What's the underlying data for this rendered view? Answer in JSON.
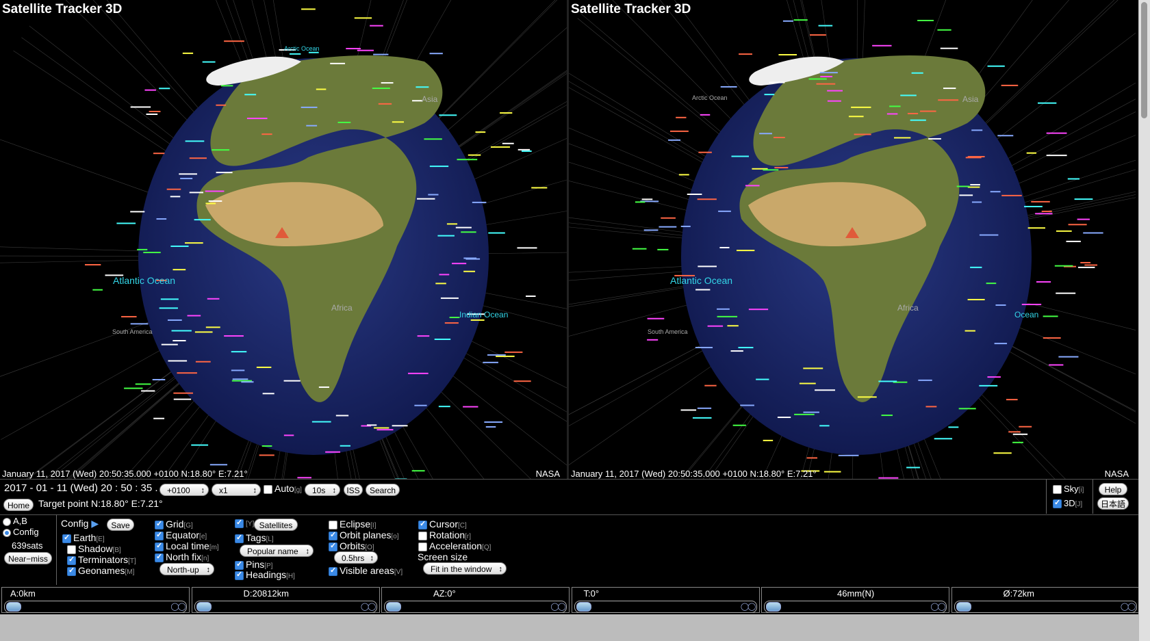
{
  "views": [
    {
      "title": "Satellite Tracker 3D",
      "status": "January 11, 2017 (Wed) 20:50:35.000 +0100 N:18.80° E:7.21°",
      "credit": "NASA",
      "labels": {
        "atlantic": "Atlantic Ocean",
        "indian": "Indian Ocean",
        "africa": "Africa",
        "asia": "Asia",
        "south_america": "South America",
        "arctic": "Arctic Ocean"
      }
    },
    {
      "title": "Satellite Tracker 3D",
      "status": "January 11, 2017 (Wed) 20:50:35.000 +0100 N:18.80° E:7.21°",
      "credit": "NASA",
      "labels": {
        "atlantic": "Atlantic Ocean",
        "indian": "Ocean",
        "africa": "Africa",
        "asia": "Asia",
        "south_america": "South America",
        "arctic": "Arctic Ocean"
      }
    }
  ],
  "time_bar": {
    "datetime": "2017 - 01 - 11 (Wed) 20 : 50 : 35 . 000",
    "timezone": "+0100",
    "speed": "x1",
    "auto_label": "Auto",
    "auto_key": "[g]",
    "interval": "10s",
    "iss_button": "ISS",
    "search_button": "Search",
    "home_button": "Home",
    "target_point": "Target point N:18.80° E:7.21°",
    "sky_label": "Sky",
    "sky_key": "[i]",
    "threed_label": "3D",
    "threed_key": "[J]",
    "help_button": "Help",
    "lang_button": "日本語"
  },
  "config_bar": {
    "mode_ab": "A,B",
    "mode_config": "Config",
    "sat_count": "639sats",
    "near_miss_button": "Near−miss",
    "config_title": "Config",
    "save_button": "Save",
    "earth": {
      "label": "Earth",
      "key": "[E]"
    },
    "shadow": {
      "label": "Shadow",
      "key": "[B]"
    },
    "terminators": {
      "label": "Terminators",
      "key": "[T]"
    },
    "geonames": {
      "label": "Geonames",
      "key": "[M]"
    },
    "grid": {
      "label": "Grid",
      "key": "[G]"
    },
    "equator": {
      "label": "Equator",
      "key": "[e]"
    },
    "localtime": {
      "label": "Local time",
      "key": "[m]"
    },
    "northfix": {
      "label": "North fix",
      "key": "[n]"
    },
    "northup_select": "North-up",
    "y_key": "[Y]",
    "satellites_button": "Satellites",
    "tags": {
      "label": "Tags",
      "key": "[L]"
    },
    "popular_select": "Popular name",
    "pins": {
      "label": "Pins",
      "key": "[P]"
    },
    "headings": {
      "label": "Headings",
      "key": "[H]"
    },
    "eclipse": {
      "label": "Eclipse",
      "key": "[I]"
    },
    "orbitplanes": {
      "label": "Orbit planes",
      "key": "[o]"
    },
    "orbits": {
      "label": "Orbits",
      "key": "[O]"
    },
    "hrs_select": "0.5hrs",
    "visible": {
      "label": "Visible areas",
      "key": "[V]"
    },
    "cursor": {
      "label": "Cursor",
      "key": "[C]"
    },
    "rotation": {
      "label": "Rotation",
      "key": "[r]"
    },
    "acceleration": {
      "label": "Acceleration",
      "key": "[Q]"
    },
    "screen_size_label": "Screen size",
    "screen_size_select": "Fit in the window"
  },
  "sliders": [
    {
      "label": "A:0km",
      "value": 0.0
    },
    {
      "label": "D:20812km",
      "value": 0.0
    },
    {
      "label": "AZ:0°",
      "value": 0.0
    },
    {
      "label": "T:0°",
      "value": 0.0
    },
    {
      "label": "46mm(N)",
      "value": 0.0
    },
    {
      "label": "Ø:72km",
      "value": 0.0
    }
  ],
  "colors": {
    "background": "#000000",
    "ocean": "#1c2a6e",
    "land": "#6b7a3a",
    "desert": "#c9a86a",
    "label_cyan": "#33d6e8",
    "accent": "#3b8ae6"
  }
}
